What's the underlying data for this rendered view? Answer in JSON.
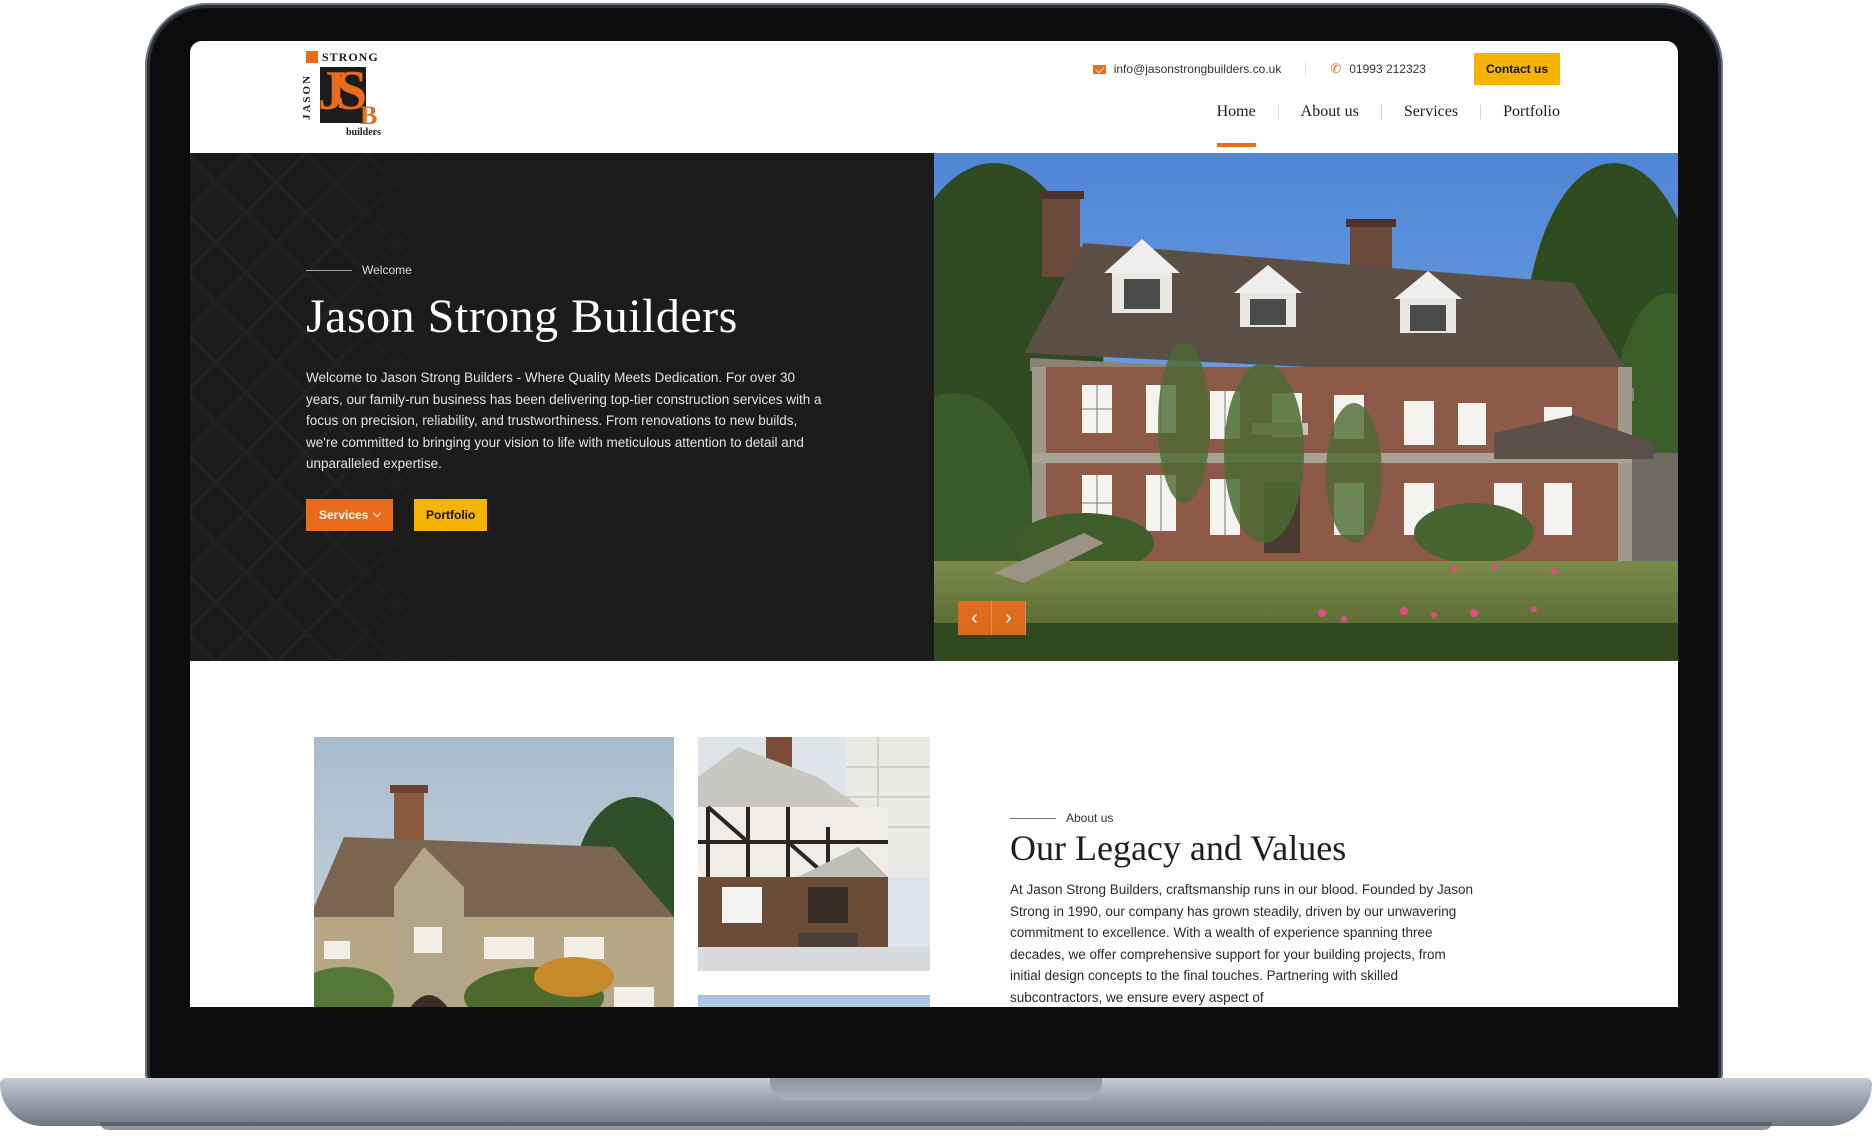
{
  "header": {
    "logo": {
      "top": "STRONG",
      "side": "JASON",
      "initials": "JS",
      "initial_b": "B",
      "bottom": "builders"
    },
    "email": "info@jasonstrongbuilders.co.uk",
    "phone": "01993 212323",
    "contact_label": "Contact us",
    "nav": [
      {
        "label": "Home",
        "active": true
      },
      {
        "label": "About us",
        "active": false
      },
      {
        "label": "Services",
        "active": false
      },
      {
        "label": "Portfolio",
        "active": false
      }
    ]
  },
  "hero": {
    "eyebrow": "Welcome",
    "title": "Jason Strong Builders",
    "text": "Welcome to Jason Strong Builders - Where Quality Meets Dedication. For over 30 years, our family-run business has been delivering top-tier construction services with a focus on precision, reliability, and  trustworthiness. From renovations to new builds, we're committed to bringing your vision to life with meticulous attention to detail and unparalleled expertise.",
    "services_label": "Services",
    "portfolio_label": "Portfolio",
    "prev_glyph": "‹",
    "next_glyph": "›"
  },
  "about": {
    "eyebrow": "About us",
    "title": "Our Legacy and Values",
    "text": "At Jason Strong Builders, craftsmanship runs in our blood. Founded by Jason Strong in 1990, our company has grown steadily, driven by our unwavering commitment to excellence. With a wealth of experience spanning three decades, we offer comprehensive support for your building  projects, from initial design concepts to the final touches. Partnering with skilled subcontractors, we ensure every aspect of"
  },
  "colors": {
    "accent_orange": "#e96b1c",
    "accent_yellow": "#f6b400",
    "hero_dark": "#1b1b1c"
  }
}
